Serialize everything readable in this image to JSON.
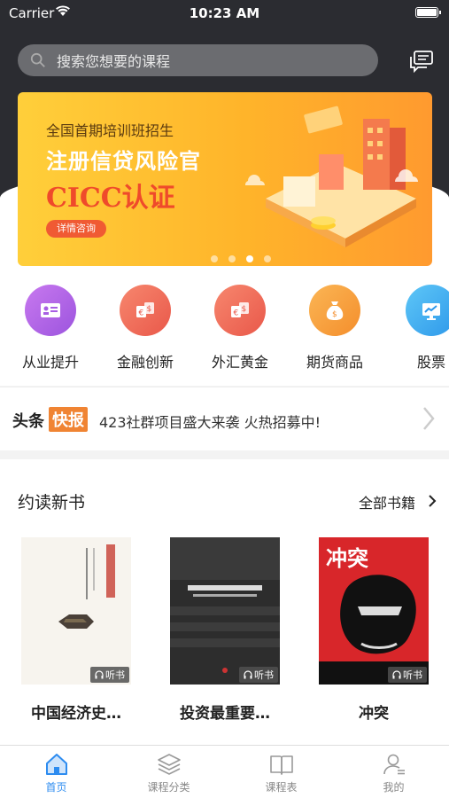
{
  "status_bar": {
    "carrier": "Carrier",
    "time": "10:23 AM"
  },
  "search": {
    "placeholder": "搜索您想要的课程"
  },
  "banner": {
    "line1": "全国首期培训班招生",
    "line2": "注册信贷风险官",
    "line3": "CICC认证",
    "button": "详情咨询",
    "dots": 4,
    "active_dot": 3
  },
  "categories": [
    {
      "label": "从业提升",
      "icon": "id-card-icon",
      "color": "#b264e3"
    },
    {
      "label": "金融创新",
      "icon": "currency-exchange-icon",
      "color": "#f06a5a"
    },
    {
      "label": "外汇黄金",
      "icon": "currency-exchange-icon",
      "color": "#f06a5a"
    },
    {
      "label": "期货商品",
      "icon": "money-bag-icon",
      "color": "#f7a240"
    },
    {
      "label": "股票",
      "icon": "stock-chart-icon",
      "color": "#3fb0f0"
    }
  ],
  "news": {
    "tag1": "头条",
    "tag2": "快报",
    "text": "423社群项目盛大来袭 火热招募中!"
  },
  "books": {
    "title": "约读新书",
    "more": "全部书籍",
    "badge": "听书",
    "items": [
      {
        "name": "中国经济史…"
      },
      {
        "name": "投资最重要…"
      },
      {
        "name": "冲突"
      }
    ]
  },
  "tabs": [
    {
      "label": "首页",
      "icon": "home-icon",
      "active": true
    },
    {
      "label": "课程分类",
      "icon": "layers-icon",
      "active": false
    },
    {
      "label": "课程表",
      "icon": "book-icon",
      "active": false
    },
    {
      "label": "我的",
      "icon": "profile-icon",
      "active": false
    }
  ],
  "colors": {
    "accent": "#2d8cf0",
    "news_tag": "#f08433",
    "banner_cta": "#f05a33"
  }
}
